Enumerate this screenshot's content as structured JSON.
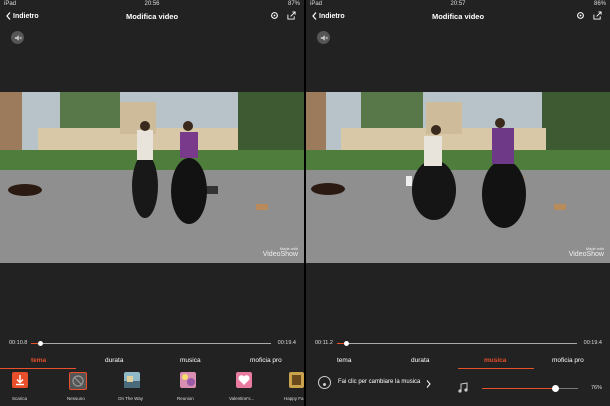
{
  "left": {
    "status": {
      "device": "iPad",
      "time": "20:56",
      "battery": "87%"
    },
    "nav": {
      "back_label": "Indietro",
      "title": "Modifica video"
    },
    "watermark": {
      "top": "Made with",
      "brand": "VideoShow"
    },
    "timeline": {
      "current": "00:10.8",
      "total": "00:19.4",
      "progress": 0.04
    },
    "tabs": [
      "tema",
      "durata",
      "musica",
      "moficia pro"
    ],
    "active_tab": 0,
    "themes": [
      {
        "label": "Scarica",
        "icon": "download-icon",
        "color": "#e8502b"
      },
      {
        "label": "Nessuno",
        "icon": "none-icon",
        "color": "#555555"
      },
      {
        "label": "On The Way",
        "icon": "theme-thumb",
        "color": "#8fb8c8"
      },
      {
        "label": "Reunion",
        "icon": "theme-thumb",
        "color": "#d98fb0"
      },
      {
        "label": "Valentine's...",
        "icon": "theme-thumb",
        "color": "#e97aa0"
      },
      {
        "label": "Happy Fa",
        "icon": "theme-thumb",
        "color": "#c9a24b"
      }
    ]
  },
  "right": {
    "status": {
      "device": "iPad",
      "time": "20:57",
      "battery": "86%"
    },
    "nav": {
      "back_label": "Indietro",
      "title": "Modifica video"
    },
    "watermark": {
      "top": "Made with",
      "brand": "VideoShow"
    },
    "timeline": {
      "current": "00:11.2",
      "total": "00:19.4",
      "progress": 0.04
    },
    "tabs": [
      "tema",
      "durata",
      "musica",
      "moficia pro"
    ],
    "active_tab": 2,
    "music": {
      "change_label": "Fai clic per cambiare la musica",
      "volume_label": "76%",
      "volume": 0.76
    }
  },
  "colors": {
    "accent": "#e8502b",
    "panel_bg": "#222222"
  }
}
